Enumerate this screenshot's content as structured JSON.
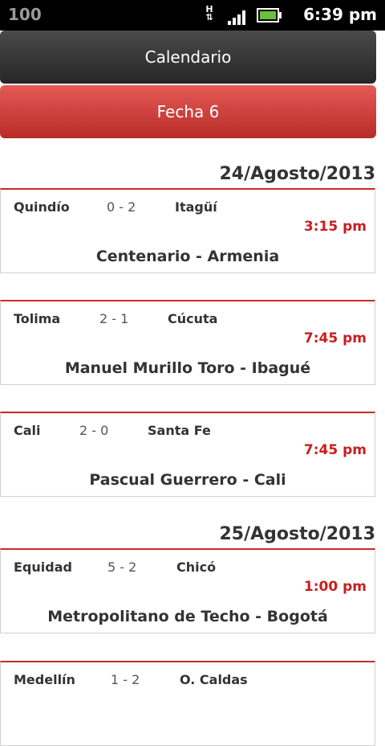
{
  "status_bar": {
    "battery_percent": "100",
    "network": "H",
    "time": "6:39 pm"
  },
  "header": {
    "calendar_label": "Calendario",
    "round_label": "Fecha 6"
  },
  "sections": [
    {
      "date": "24/Agosto/2013",
      "matches": [
        {
          "home": "Quindío",
          "score": "0 - 2",
          "away": "Itagüí",
          "time": "3:15 pm",
          "venue": "Centenario - Armenia"
        },
        {
          "home": "Tolima",
          "score": "2 - 1",
          "away": "Cúcuta",
          "time": "7:45 pm",
          "venue": "Manuel Murillo Toro - Ibagué"
        },
        {
          "home": "Cali",
          "score": "2 - 0",
          "away": "Santa Fe",
          "time": "7:45 pm",
          "venue": "Pascual Guerrero - Cali"
        }
      ]
    },
    {
      "date": "25/Agosto/2013",
      "matches": [
        {
          "home": "Equidad",
          "score": "5 - 2",
          "away": "Chicó",
          "time": "1:00 pm",
          "venue": "Metropolitano de Techo - Bogotá"
        },
        {
          "home": "Medellín",
          "score": "1 - 2",
          "away": "O. Caldas",
          "time": "",
          "venue": ""
        }
      ]
    }
  ]
}
